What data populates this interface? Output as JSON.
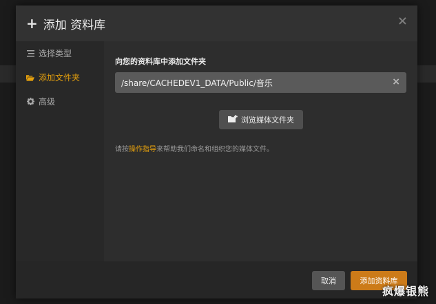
{
  "dialog": {
    "title": "添加 资料库",
    "close_symbol": "×"
  },
  "sidebar": {
    "items": [
      {
        "label": "选择类型",
        "icon": "list-icon",
        "active": false
      },
      {
        "label": "添加文件夹",
        "icon": "folder-open-icon",
        "active": true
      },
      {
        "label": "高级",
        "icon": "gear-icon",
        "active": false
      }
    ]
  },
  "main": {
    "section_label": "向您的资料库中添加文件夹",
    "folder_path_value": "/share/CACHEDEV1_DATA/Public/音乐",
    "clear_symbol": "×",
    "browse_button_label": "浏览媒体文件夹",
    "help_prefix": "请按",
    "help_link": "操作指导",
    "help_suffix": "来帮助我们命名和组织您的媒体文件。"
  },
  "footer": {
    "cancel_label": "取消",
    "add_label": "添加资料库"
  },
  "watermark": "疯爆银熊",
  "colors": {
    "accent": "#e5a00d",
    "primary_button": "#cc7b19",
    "dialog_bg": "#2d2d2d",
    "sidebar_bg": "#282828"
  }
}
